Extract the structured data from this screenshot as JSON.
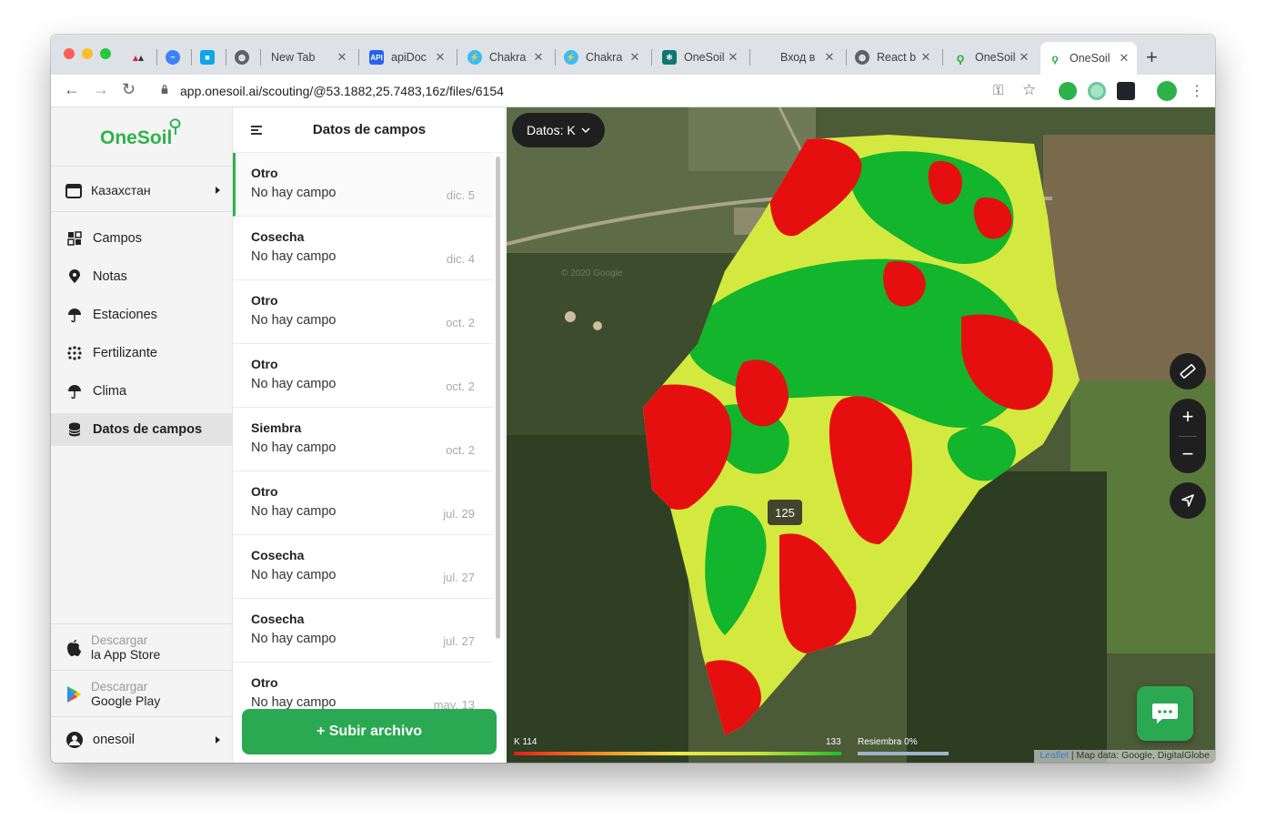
{
  "browser": {
    "tabs": [
      {
        "label": "",
        "icon": "triangles-icon",
        "color": "#e11d48"
      },
      {
        "label": "",
        "icon": "pulse-icon",
        "color": "#3b82f6"
      },
      {
        "label": "",
        "icon": "blocks-icon",
        "color": "#0ea5e9"
      },
      {
        "label": "New Tab",
        "icon": "globe-icon",
        "color": "#5f6368"
      },
      {
        "label": "apiDoc",
        "icon": "api-icon",
        "color": "#2563eb"
      },
      {
        "label": "Chakra",
        "icon": "chakra-icon",
        "color": "#38bdf8"
      },
      {
        "label": "Chakra",
        "icon": "chakra-icon",
        "color": "#38bdf8"
      },
      {
        "label": "OneSoil",
        "icon": "react-icon",
        "color": "#0f766e"
      },
      {
        "label": "Вход в",
        "icon": "apple-icon",
        "color": "#222222"
      },
      {
        "label": "React b",
        "icon": "globe-icon",
        "color": "#5f6368"
      },
      {
        "label": "OneSoil",
        "icon": "onesoil-icon",
        "color": "#2db34a"
      },
      {
        "label": "OneSoil",
        "icon": "onesoil-icon",
        "color": "#2db34a",
        "active": true
      }
    ],
    "url": "app.onesoil.ai/scouting/@53.1882,25.7483,16z/files/6154"
  },
  "sidebar": {
    "logo": "OneSoil",
    "country": "Казахстан",
    "nav": [
      {
        "label": "Campos",
        "icon": "fields-icon"
      },
      {
        "label": "Notas",
        "icon": "pin-icon"
      },
      {
        "label": "Estaciones",
        "icon": "umbrella-icon"
      },
      {
        "label": "Fertilizante",
        "icon": "fertilizer-icon"
      },
      {
        "label": "Clima",
        "icon": "umbrella-icon"
      },
      {
        "label": "Datos de campos",
        "icon": "database-icon",
        "active": true
      }
    ],
    "appstore": {
      "line1": "Descargar",
      "line2": "la App Store"
    },
    "googleplay": {
      "line1": "Descargar",
      "line2": "Google Play"
    },
    "user": "onesoil"
  },
  "files": {
    "title": "Datos de campos",
    "items": [
      {
        "type": "Otro",
        "sub": "No hay campo",
        "date": "dic. 5"
      },
      {
        "type": "Cosecha",
        "sub": "No hay campo",
        "date": "dic. 4"
      },
      {
        "type": "Otro",
        "sub": "No hay campo",
        "date": "oct. 2"
      },
      {
        "type": "Otro",
        "sub": "No hay campo",
        "date": "oct. 2"
      },
      {
        "type": "Siembra",
        "sub": "No hay campo",
        "date": "oct. 2"
      },
      {
        "type": "Otro",
        "sub": "No hay campo",
        "date": "jul. 29"
      },
      {
        "type": "Cosecha",
        "sub": "No hay campo",
        "date": "jul. 27"
      },
      {
        "type": "Cosecha",
        "sub": "No hay campo",
        "date": "jul. 27"
      },
      {
        "type": "Otro",
        "sub": "No hay campo",
        "date": "may. 13"
      }
    ],
    "upload_label": "+ Subir archivo"
  },
  "map": {
    "data_selector": "Datos: K",
    "tooltip_value": "125",
    "legend_min": "K 114",
    "legend_max": "133",
    "resiembra": "Resiembra 0%",
    "attribution_link": "Leaflet",
    "attribution_text": " | Map data: Google, DigitalGlobe",
    "watermark": "© 2020 Google"
  },
  "colors": {
    "brand_green": "#2db34a",
    "zone_high": "#12b52c",
    "zone_mid": "#d4e93f",
    "zone_low": "#e60f0f"
  }
}
